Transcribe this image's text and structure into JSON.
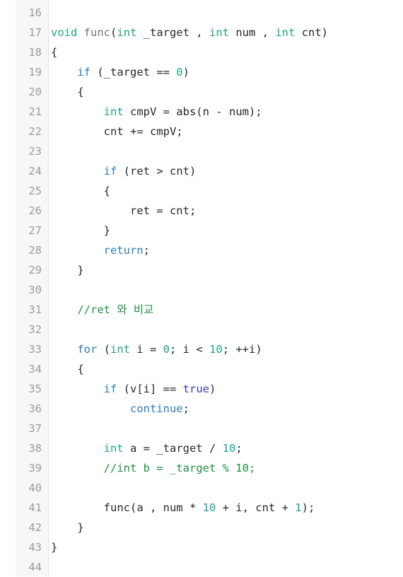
{
  "editor": {
    "name": "code-viewer",
    "language": "cpp",
    "background_color": "#ffffff",
    "gutter_background_color": "#f7f7f7",
    "gutter_divider_color": "#e2e2e2",
    "line_number_color": "#9b9b9b",
    "default_text_color": "#24292e",
    "first_line_number": 16,
    "last_line_number": 44,
    "token_colors": {
      "keyword": "#2b7bba",
      "type": "#1fa18c",
      "number": "#1fa18c",
      "comment": "#1e9141",
      "literal": "#3b3bbf",
      "function": "#6f7478",
      "plain": "#24292e"
    }
  },
  "lines": [
    {
      "number": "16",
      "text": "",
      "tokens": []
    },
    {
      "number": "17",
      "text": "void func(int _target , int num , int cnt)",
      "tokens": [
        {
          "t": "void",
          "c": "type"
        },
        {
          "t": " ",
          "c": "plain"
        },
        {
          "t": "func",
          "c": "func"
        },
        {
          "t": "(",
          "c": "plain"
        },
        {
          "t": "int",
          "c": "type"
        },
        {
          "t": " _target , ",
          "c": "plain"
        },
        {
          "t": "int",
          "c": "type"
        },
        {
          "t": " num , ",
          "c": "plain"
        },
        {
          "t": "int",
          "c": "type"
        },
        {
          "t": " cnt)",
          "c": "plain"
        }
      ]
    },
    {
      "number": "18",
      "text": "{",
      "tokens": [
        {
          "t": "{",
          "c": "plain"
        }
      ]
    },
    {
      "number": "19",
      "text": "    if (_target == 0)",
      "tokens": [
        {
          "t": "    ",
          "c": "plain"
        },
        {
          "t": "if",
          "c": "keyword"
        },
        {
          "t": " (_target == ",
          "c": "plain"
        },
        {
          "t": "0",
          "c": "number"
        },
        {
          "t": ")",
          "c": "plain"
        }
      ]
    },
    {
      "number": "20",
      "text": "    {",
      "tokens": [
        {
          "t": "    {",
          "c": "plain"
        }
      ]
    },
    {
      "number": "21",
      "text": "        int cmpV = abs(n - num);",
      "tokens": [
        {
          "t": "        ",
          "c": "plain"
        },
        {
          "t": "int",
          "c": "type"
        },
        {
          "t": " cmpV = abs(n - num);",
          "c": "plain"
        }
      ]
    },
    {
      "number": "22",
      "text": "        cnt += cmpV;",
      "tokens": [
        {
          "t": "        cnt += cmpV;",
          "c": "plain"
        }
      ]
    },
    {
      "number": "23",
      "text": "",
      "tokens": []
    },
    {
      "number": "24",
      "text": "        if (ret > cnt)",
      "tokens": [
        {
          "t": "        ",
          "c": "plain"
        },
        {
          "t": "if",
          "c": "keyword"
        },
        {
          "t": " (ret > cnt)",
          "c": "plain"
        }
      ]
    },
    {
      "number": "25",
      "text": "        {",
      "tokens": [
        {
          "t": "        {",
          "c": "plain"
        }
      ]
    },
    {
      "number": "26",
      "text": "            ret = cnt;",
      "tokens": [
        {
          "t": "            ret = cnt;",
          "c": "plain"
        }
      ]
    },
    {
      "number": "27",
      "text": "        }",
      "tokens": [
        {
          "t": "        }",
          "c": "plain"
        }
      ]
    },
    {
      "number": "28",
      "text": "        return;",
      "tokens": [
        {
          "t": "        ",
          "c": "plain"
        },
        {
          "t": "return",
          "c": "keyword"
        },
        {
          "t": ";",
          "c": "plain"
        }
      ]
    },
    {
      "number": "29",
      "text": "    }",
      "tokens": [
        {
          "t": "    }",
          "c": "plain"
        }
      ]
    },
    {
      "number": "30",
      "text": "",
      "tokens": []
    },
    {
      "number": "31",
      "text": "    //ret 와 비교",
      "tokens": [
        {
          "t": "    ",
          "c": "plain"
        },
        {
          "t": "//ret 와 비교",
          "c": "comment"
        }
      ]
    },
    {
      "number": "32",
      "text": "",
      "tokens": []
    },
    {
      "number": "33",
      "text": "    for (int i = 0; i < 10; ++i)",
      "tokens": [
        {
          "t": "    ",
          "c": "plain"
        },
        {
          "t": "for",
          "c": "keyword"
        },
        {
          "t": " (",
          "c": "plain"
        },
        {
          "t": "int",
          "c": "type"
        },
        {
          "t": " i = ",
          "c": "plain"
        },
        {
          "t": "0",
          "c": "number"
        },
        {
          "t": "; i < ",
          "c": "plain"
        },
        {
          "t": "10",
          "c": "number"
        },
        {
          "t": "; ++i)",
          "c": "plain"
        }
      ]
    },
    {
      "number": "34",
      "text": "    {",
      "tokens": [
        {
          "t": "    {",
          "c": "plain"
        }
      ]
    },
    {
      "number": "35",
      "text": "        if (v[i] == true)",
      "tokens": [
        {
          "t": "        ",
          "c": "plain"
        },
        {
          "t": "if",
          "c": "keyword"
        },
        {
          "t": " (v[i] == ",
          "c": "plain"
        },
        {
          "t": "true",
          "c": "literal"
        },
        {
          "t": ")",
          "c": "plain"
        }
      ]
    },
    {
      "number": "36",
      "text": "            continue;",
      "tokens": [
        {
          "t": "            ",
          "c": "plain"
        },
        {
          "t": "continue",
          "c": "keyword"
        },
        {
          "t": ";",
          "c": "plain"
        }
      ]
    },
    {
      "number": "37",
      "text": "",
      "tokens": []
    },
    {
      "number": "38",
      "text": "        int a = _target / 10;",
      "tokens": [
        {
          "t": "        ",
          "c": "plain"
        },
        {
          "t": "int",
          "c": "type"
        },
        {
          "t": " a = _target / ",
          "c": "plain"
        },
        {
          "t": "10",
          "c": "number"
        },
        {
          "t": ";",
          "c": "plain"
        }
      ]
    },
    {
      "number": "39",
      "text": "        //int b = _target % 10;",
      "tokens": [
        {
          "t": "        ",
          "c": "plain"
        },
        {
          "t": "//int b = _target % 10;",
          "c": "comment"
        }
      ]
    },
    {
      "number": "40",
      "text": "",
      "tokens": []
    },
    {
      "number": "41",
      "text": "        func(a , num * 10 + i, cnt + 1);",
      "tokens": [
        {
          "t": "        func(a , num * ",
          "c": "plain"
        },
        {
          "t": "10",
          "c": "number"
        },
        {
          "t": " + i, cnt + ",
          "c": "plain"
        },
        {
          "t": "1",
          "c": "number"
        },
        {
          "t": ");",
          "c": "plain"
        }
      ]
    },
    {
      "number": "42",
      "text": "    }",
      "tokens": [
        {
          "t": "    }",
          "c": "plain"
        }
      ]
    },
    {
      "number": "43",
      "text": "}",
      "tokens": [
        {
          "t": "}",
          "c": "plain"
        }
      ]
    },
    {
      "number": "44",
      "text": "",
      "tokens": []
    }
  ]
}
